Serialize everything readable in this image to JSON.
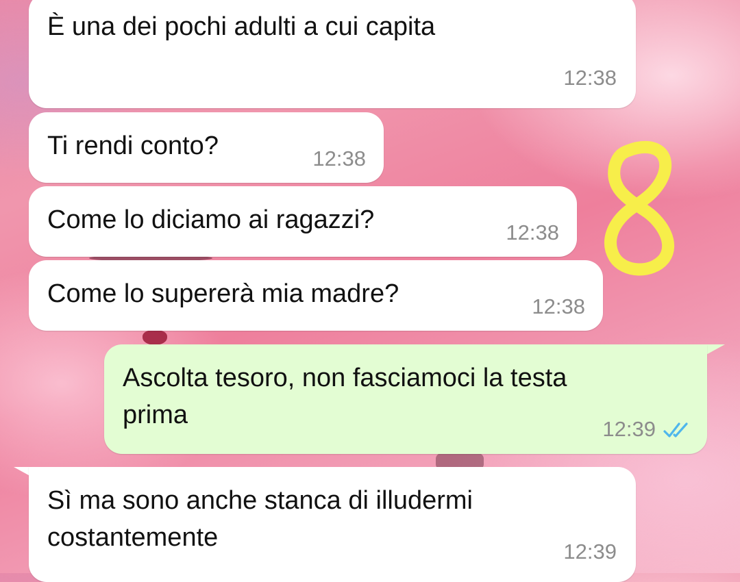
{
  "chat": {
    "messages": [
      {
        "direction": "incoming",
        "text": "È una dei pochi adulti a cui capita",
        "time": "12:38"
      },
      {
        "direction": "incoming",
        "text": "Ti rendi conto?",
        "time": "12:38"
      },
      {
        "direction": "incoming",
        "text": "Come lo diciamo ai ragazzi?",
        "time": "12:38"
      },
      {
        "direction": "incoming",
        "text": "Come lo supererà mia madre?",
        "time": "12:38"
      },
      {
        "direction": "outgoing",
        "text": "Ascolta tesoro, non fasciamoci la testa\nprima",
        "time": "12:39",
        "status_icon": "double-check-read-icon"
      },
      {
        "direction": "incoming",
        "text": "Sì ma sono anche stanca di illudermi\ncostantemente",
        "time": "12:39"
      }
    ]
  },
  "annotation": {
    "text": "8",
    "color": "#f7ee4a"
  },
  "colors": {
    "incoming_bubble": "#ffffff",
    "outgoing_bubble": "#e3fdd3",
    "timestamp": "#8c8c8c",
    "read_ticks": "#4fb6ec"
  }
}
